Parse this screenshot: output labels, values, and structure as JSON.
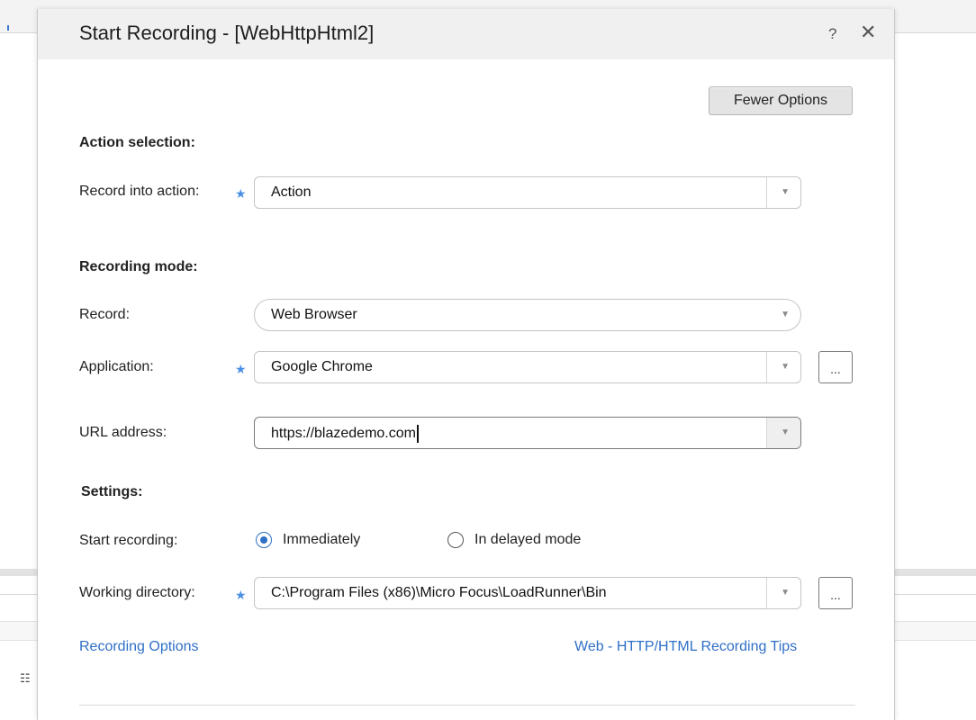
{
  "dialog": {
    "title": "Start Recording - [WebHttpHtml2]",
    "help_glyph": "?",
    "close_glyph": "✕",
    "fewer_options_label": "Fewer Options"
  },
  "action_selection": {
    "heading": "Action selection:",
    "record_into_label": "Record into action:",
    "record_into_value": "Action"
  },
  "recording_mode": {
    "heading": "Recording mode:",
    "record_label": "Record:",
    "record_value": "Web Browser",
    "application_label": "Application:",
    "application_value": "Google Chrome",
    "url_label": "URL address:",
    "url_value": "https://blazedemo.com"
  },
  "settings": {
    "heading": "Settings:",
    "start_label": "Start recording:",
    "option_immediately": "Immediately",
    "option_delayed": "In delayed mode",
    "selected": "Immediately",
    "working_dir_label": "Working directory:",
    "working_dir_value": "C:\\Program Files (x86)\\Micro Focus\\LoadRunner\\Bin"
  },
  "links": {
    "recording_options": "Recording Options",
    "tips": "Web - HTTP/HTML Recording Tips"
  },
  "common": {
    "required_mark": "★",
    "ellipsis": "...",
    "dropdown_arrow": "▼"
  },
  "colors": {
    "accent": "#2f6fc7",
    "required": "#4a90e2",
    "titlebar_bg": "#f0f0f0"
  }
}
